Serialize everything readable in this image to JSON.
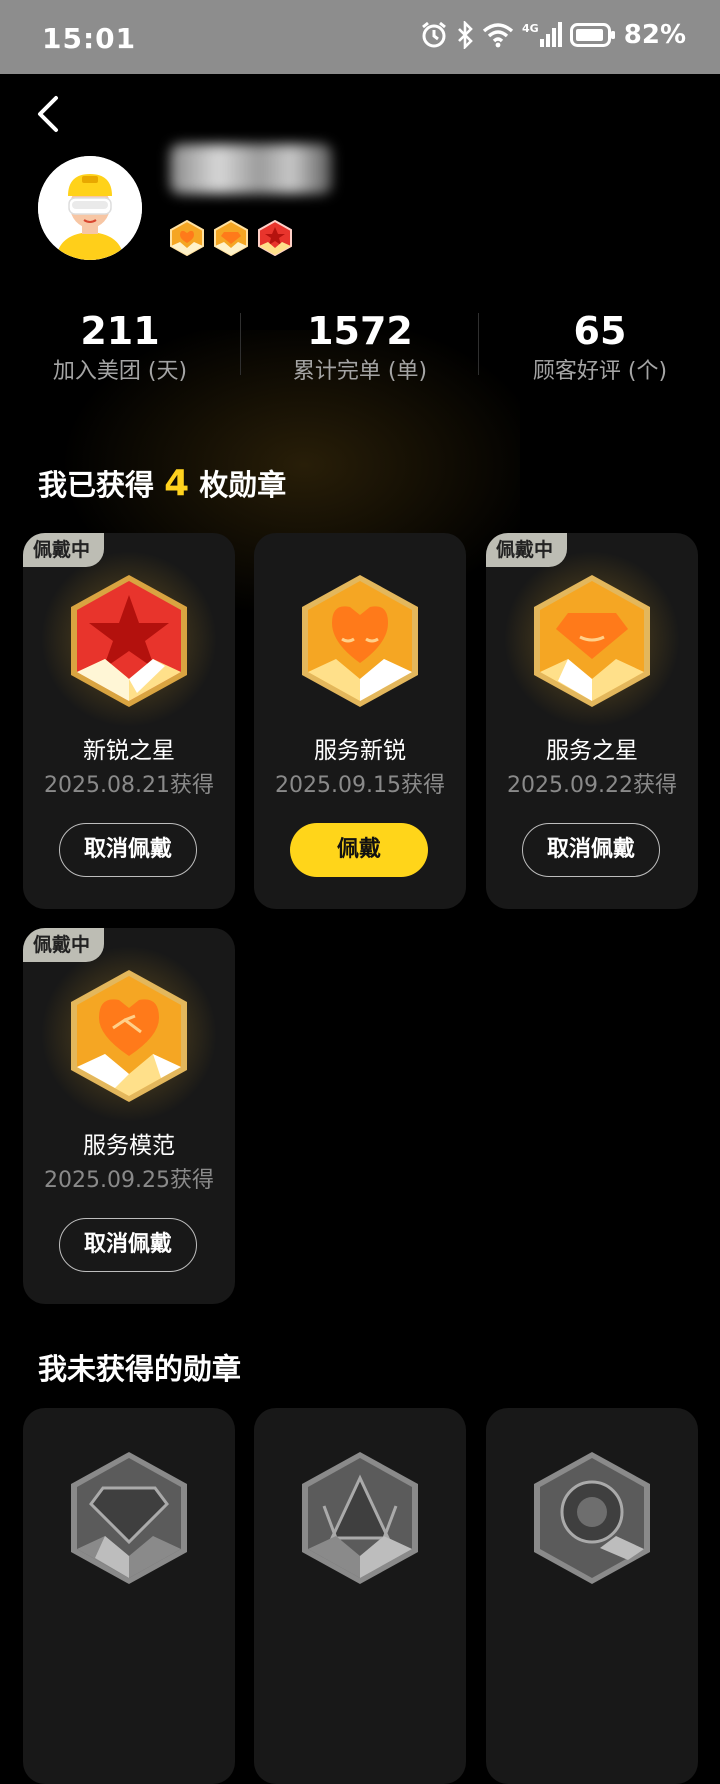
{
  "status_bar": {
    "time": "15:01",
    "network": "4G",
    "battery": "82%"
  },
  "profile": {
    "name_redacted": true
  },
  "stats": [
    {
      "value": "211",
      "label": "加入美团 (天)"
    },
    {
      "value": "1572",
      "label": "累计完单 (单)"
    },
    {
      "value": "65",
      "label": "顾客好评 (个)"
    }
  ],
  "earned_section": {
    "prefix": "我已获得",
    "count": "4",
    "suffix": "枚勋章"
  },
  "earned_badges": [
    {
      "title": "新锐之星",
      "date": "2025.08.21获得",
      "tag": "佩戴中",
      "button": "取消佩戴",
      "color": "#e8342c",
      "icon": "star-medal-icon"
    },
    {
      "title": "服务新锐",
      "date": "2025.09.15获得",
      "tag": "",
      "button": "佩戴",
      "color": "#f5a623",
      "icon": "heart-medal-icon"
    },
    {
      "title": "服务之星",
      "date": "2025.09.22获得",
      "tag": "佩戴中",
      "button": "取消佩戴",
      "color": "#f5a623",
      "icon": "diamond-medal-icon"
    },
    {
      "title": "服务模范",
      "date": "2025.09.25获得",
      "tag": "佩戴中",
      "button": "取消佩戴",
      "color": "#f5a623",
      "icon": "handshake-medal-icon"
    }
  ],
  "unearned_section": {
    "title": "我未获得的勋章"
  },
  "unearned_badges": [
    {
      "icon": "diamond-locked-icon"
    },
    {
      "icon": "crown-locked-icon"
    },
    {
      "icon": "target-locked-icon"
    }
  ],
  "colors": {
    "accent": "#ffd21e",
    "card_bg": "#181818",
    "tag_bg": "#bdbdb4"
  }
}
